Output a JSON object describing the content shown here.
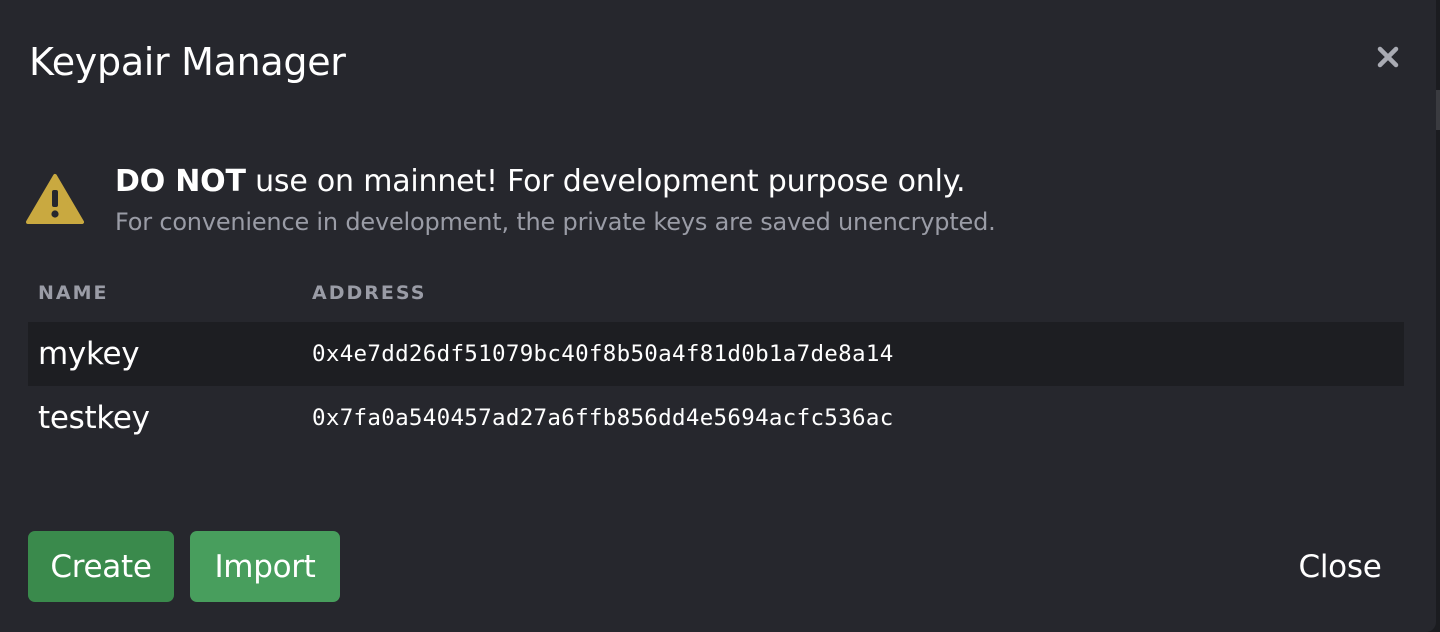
{
  "dialog": {
    "title": "Keypair Manager",
    "close_icon": "close-icon"
  },
  "warning": {
    "icon": "warning-icon",
    "strong": "DO NOT",
    "message": " use on mainnet! For development purpose only.",
    "sub": "For convenience in development, the private keys are saved unencrypted."
  },
  "table": {
    "headers": {
      "name": "NAME",
      "address": "ADDRESS"
    },
    "rows": [
      {
        "name": "mykey",
        "address": "0x4e7dd26df51079bc40f8b50a4f81d0b1a7de8a14"
      },
      {
        "name": "testkey",
        "address": "0x7fa0a540457ad27a6ffb856dd4e5694acfc536ac"
      }
    ]
  },
  "footer": {
    "create_label": "Create",
    "import_label": "Import",
    "close_label": "Close"
  },
  "colors": {
    "modal_bg": "#26272d",
    "row_stripe": "#1d1e22",
    "warning_yellow": "#c9a940",
    "create_green": "#3a8a4c",
    "import_green": "#489e5d",
    "muted_text": "#9a9ca6"
  }
}
